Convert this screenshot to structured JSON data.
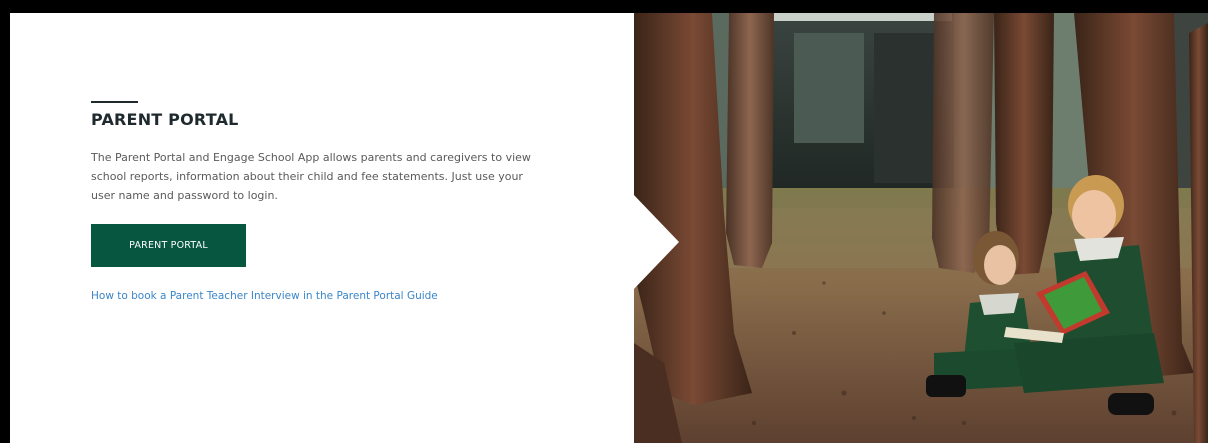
{
  "section": {
    "title": "PARENT PORTAL",
    "description": "The Parent Portal and Engage School App allows parents and caregivers to view school reports, information about their child and fee statements. Just use your user name and password to login.",
    "button_label": "PARENT PORTAL",
    "link_text": "How to book a Parent Teacher Interview in the Parent Portal Guide"
  },
  "colors": {
    "button_bg": "#075640",
    "link": "#3b86c8",
    "heading": "#1f2a2e"
  }
}
